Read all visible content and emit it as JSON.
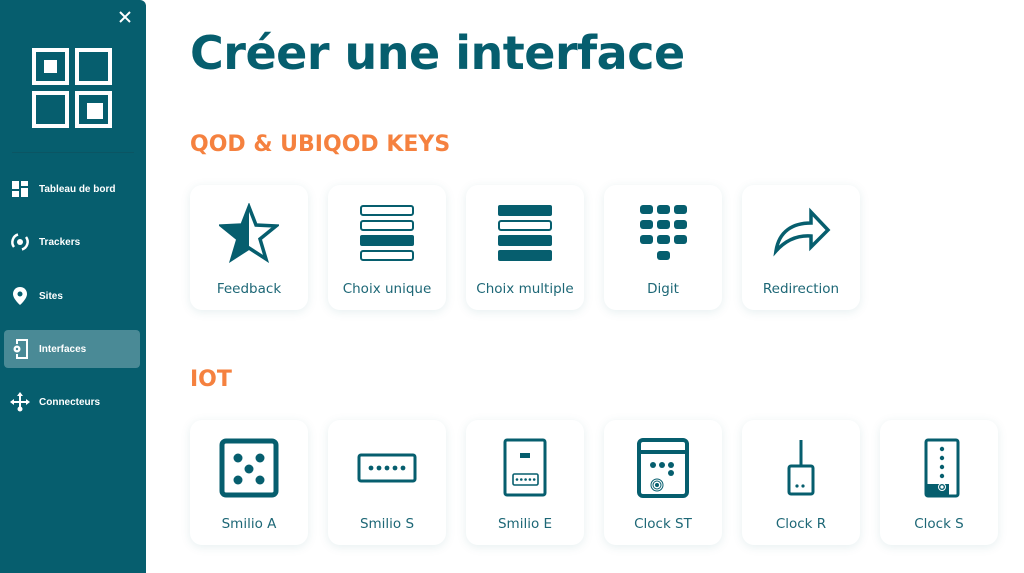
{
  "sidebar": {
    "close_icon": "close-icon",
    "logo_icon": "qr-logo-icon",
    "items": [
      {
        "label": "Tableau de bord",
        "icon": "dashboard-icon",
        "active": false
      },
      {
        "label": "Trackers",
        "icon": "trackers-icon",
        "active": false
      },
      {
        "label": "Sites",
        "icon": "location-pin-icon",
        "active": false
      },
      {
        "label": "Interfaces",
        "icon": "interfaces-icon",
        "active": true
      },
      {
        "label": "Connecteurs",
        "icon": "connectors-icon",
        "active": false
      }
    ]
  },
  "main": {
    "title": "Créer une interface",
    "sections": [
      {
        "title": "QOD & UBIQOD KEYS",
        "cards": [
          {
            "label": "Feedback",
            "icon": "half-star-icon"
          },
          {
            "label": "Choix unique",
            "icon": "single-choice-icon"
          },
          {
            "label": "Choix multiple",
            "icon": "multiple-choice-icon"
          },
          {
            "label": "Digit",
            "icon": "keypad-icon"
          },
          {
            "label": "Redirection",
            "icon": "redirect-arrow-icon"
          }
        ]
      },
      {
        "title": "IOT",
        "cards": [
          {
            "label": "Smilio A",
            "icon": "smilio-a-icon"
          },
          {
            "label": "Smilio S",
            "icon": "smilio-s-icon"
          },
          {
            "label": "Smilio E",
            "icon": "smilio-e-icon"
          },
          {
            "label": "Clock ST",
            "icon": "clock-st-icon"
          },
          {
            "label": "Clock R",
            "icon": "clock-r-icon"
          },
          {
            "label": "Clock S",
            "icon": "clock-s-icon"
          }
        ]
      }
    ]
  },
  "colors": {
    "primary": "#065e6e",
    "accent": "#f5813f",
    "active_nav": "#4a8a96"
  }
}
